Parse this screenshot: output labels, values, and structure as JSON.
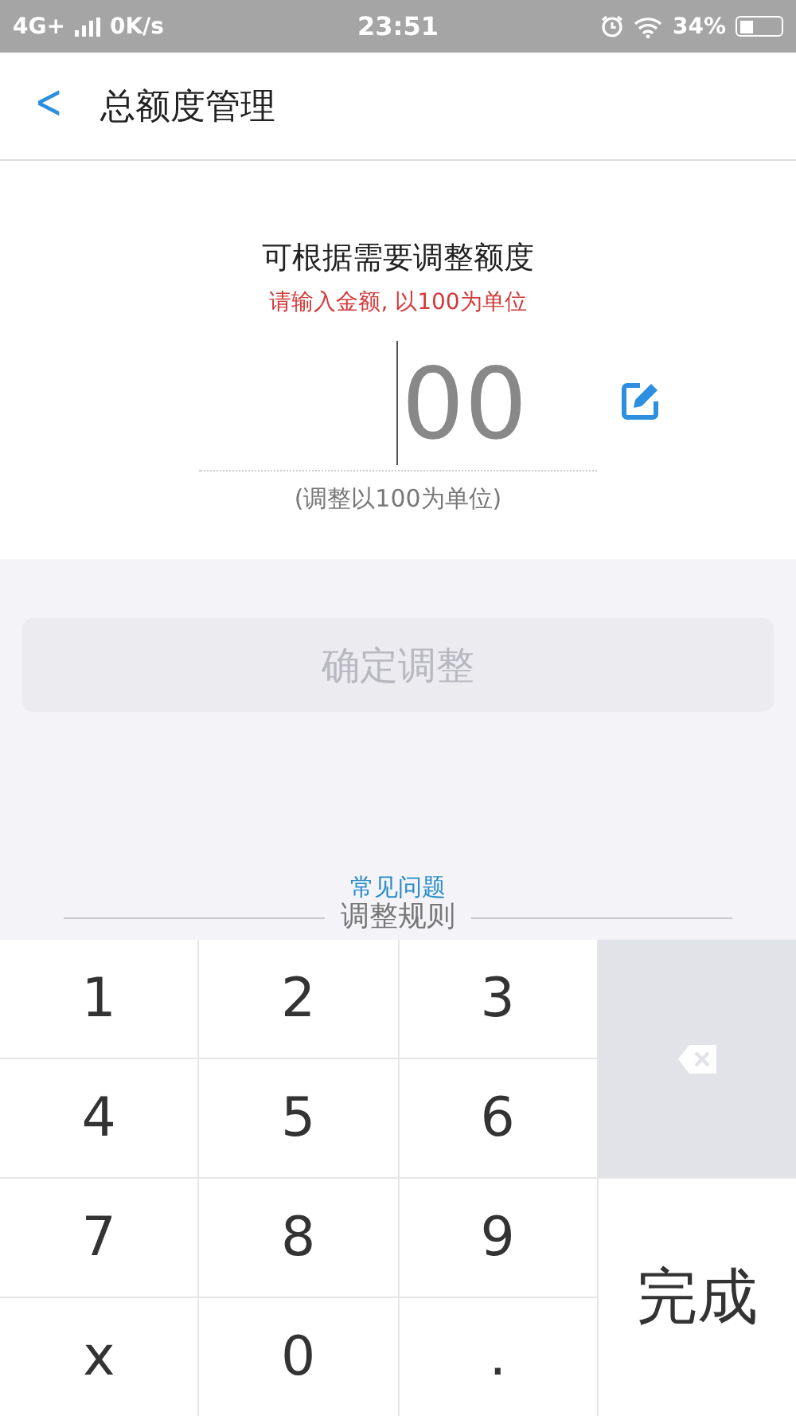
{
  "status_bar": {
    "network": "4G+",
    "speed": "0K/s",
    "time": "23:51",
    "battery": "34%"
  },
  "header": {
    "back": "<",
    "title": "总额度管理"
  },
  "amount": {
    "heading": "可根据需要调整额度",
    "hint": "请输入金额, 以100为单位",
    "value": "00",
    "note": "(调整以100为单位)"
  },
  "confirm_button": {
    "label": "确定调整",
    "disabled": true
  },
  "links": {
    "faq": "常见问题",
    "rules": "调整规则"
  },
  "keypad": {
    "keys": [
      {
        "kind": "digit",
        "label": "1"
      },
      {
        "kind": "digit",
        "label": "2"
      },
      {
        "kind": "digit",
        "label": "3"
      },
      {
        "kind": "backspace"
      },
      {
        "kind": "digit",
        "label": "4"
      },
      {
        "kind": "digit",
        "label": "5"
      },
      {
        "kind": "digit",
        "label": "6"
      },
      {
        "kind": "digit",
        "label": "7"
      },
      {
        "kind": "digit",
        "label": "8"
      },
      {
        "kind": "digit",
        "label": "9"
      },
      {
        "kind": "done",
        "label": "完成"
      },
      {
        "kind": "digit",
        "label": "x"
      },
      {
        "kind": "digit",
        "label": "0"
      },
      {
        "kind": "digit",
        "label": "."
      }
    ]
  }
}
